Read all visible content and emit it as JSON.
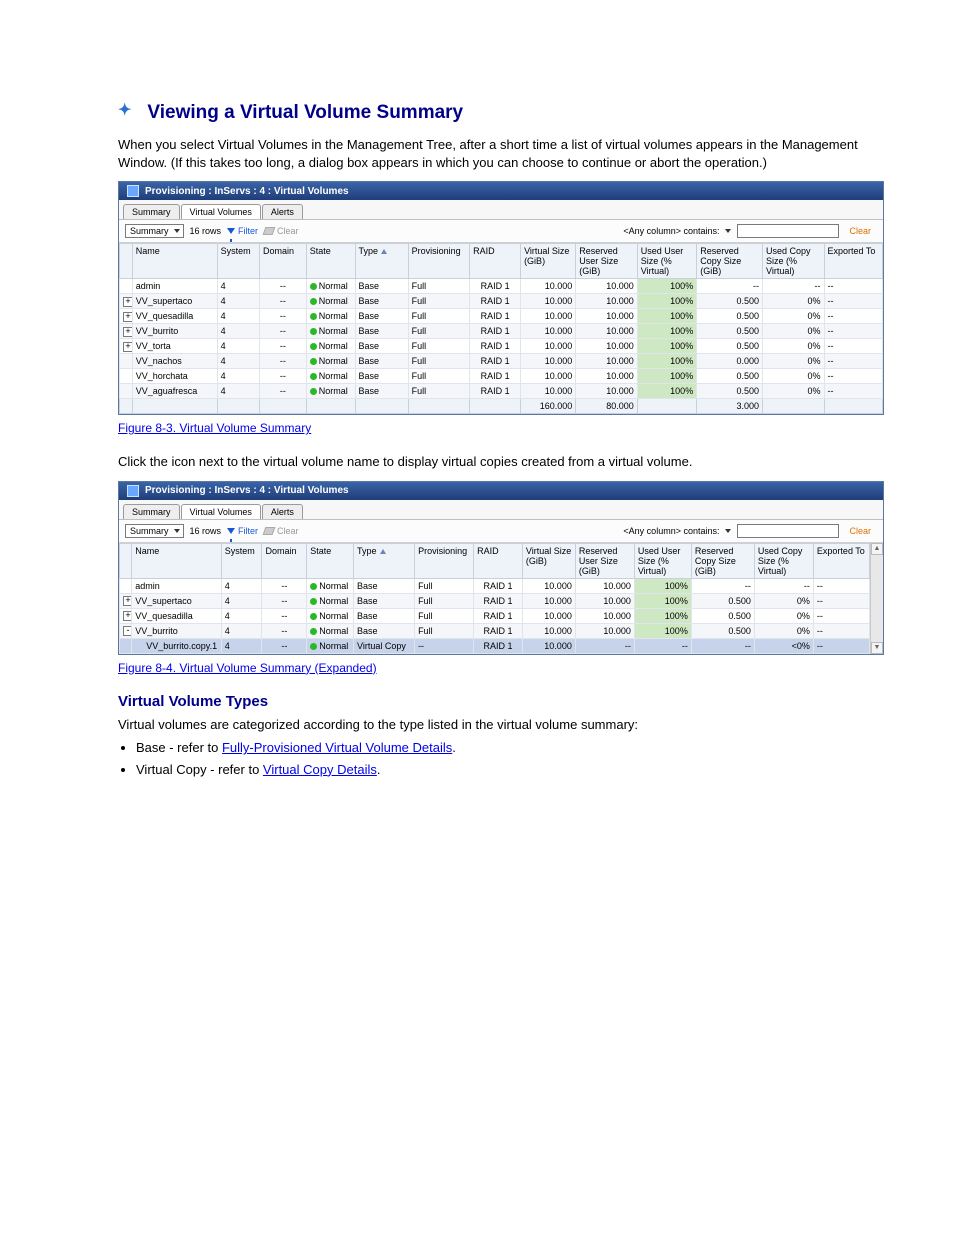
{
  "heading_top": "Viewing a Virtual Volume Summary",
  "intro": "When you select Virtual Volumes in the Management Tree, after a short time a list of virtual volumes appears in the Management Window. (If this takes too long, a dialog box appears in which you can choose to continue or abort the operation.)",
  "fig1": {
    "title": "Provisioning : InServs : 4 : Virtual Volumes",
    "tabs": [
      "Summary",
      "Virtual Volumes",
      "Alerts"
    ],
    "tabs_active": 1,
    "dropdown": "Summary",
    "rowcount": "16 rows",
    "filter_label": "Filter",
    "clear_label": "Clear",
    "anycol": "<Any column> contains:",
    "clear_link": "Clear",
    "columns": [
      "Name",
      "System",
      "Domain",
      "State",
      "Type",
      "Provisioning",
      "RAID",
      "Virtual Size (GiB)",
      "Reserved User Size (GiB)",
      "Used User Size (% Virtual)",
      "Reserved Copy Size (GiB)",
      "Used Copy Size (% Virtual)",
      "Exported To"
    ],
    "sort_col": 4,
    "rows": [
      {
        "tree": "",
        "name": "admin",
        "sys": "4",
        "dom": "--",
        "state": "Normal",
        "type": "Base",
        "prov": "Full",
        "raid": "RAID 1",
        "vs": "10.000",
        "rus": "10.000",
        "uus": "100%",
        "rcs": "--",
        "ucs": "--",
        "exp": "--"
      },
      {
        "tree": "+",
        "name": "VV_supertaco",
        "sys": "4",
        "dom": "--",
        "state": "Normal",
        "type": "Base",
        "prov": "Full",
        "raid": "RAID 1",
        "vs": "10.000",
        "rus": "10.000",
        "uus": "100%",
        "rcs": "0.500",
        "ucs": "0%",
        "exp": "--"
      },
      {
        "tree": "+",
        "name": "VV_quesadilla",
        "sys": "4",
        "dom": "--",
        "state": "Normal",
        "type": "Base",
        "prov": "Full",
        "raid": "RAID 1",
        "vs": "10.000",
        "rus": "10.000",
        "uus": "100%",
        "rcs": "0.500",
        "ucs": "0%",
        "exp": "--"
      },
      {
        "tree": "+",
        "name": "VV_burrito",
        "sys": "4",
        "dom": "--",
        "state": "Normal",
        "type": "Base",
        "prov": "Full",
        "raid": "RAID 1",
        "vs": "10.000",
        "rus": "10.000",
        "uus": "100%",
        "rcs": "0.500",
        "ucs": "0%",
        "exp": "--"
      },
      {
        "tree": "+",
        "name": "VV_torta",
        "sys": "4",
        "dom": "--",
        "state": "Normal",
        "type": "Base",
        "prov": "Full",
        "raid": "RAID 1",
        "vs": "10.000",
        "rus": "10.000",
        "uus": "100%",
        "rcs": "0.500",
        "ucs": "0%",
        "exp": "--"
      },
      {
        "tree": "",
        "name": "VV_nachos",
        "sys": "4",
        "dom": "--",
        "state": "Normal",
        "type": "Base",
        "prov": "Full",
        "raid": "RAID 1",
        "vs": "10.000",
        "rus": "10.000",
        "uus": "100%",
        "rcs": "0.000",
        "ucs": "0%",
        "exp": "--"
      },
      {
        "tree": "",
        "name": "VV_horchata",
        "sys": "4",
        "dom": "--",
        "state": "Normal",
        "type": "Base",
        "prov": "Full",
        "raid": "RAID 1",
        "vs": "10.000",
        "rus": "10.000",
        "uus": "100%",
        "rcs": "0.500",
        "ucs": "0%",
        "exp": "--"
      },
      {
        "tree": "",
        "name": "VV_aguafresca",
        "sys": "4",
        "dom": "--",
        "state": "Normal",
        "type": "Base",
        "prov": "Full",
        "raid": "RAID 1",
        "vs": "10.000",
        "rus": "10.000",
        "uus": "100%",
        "rcs": "0.500",
        "ucs": "0%",
        "exp": "--"
      }
    ],
    "footer": {
      "vs": "160.000",
      "rus": "80.000",
      "rcs": "3.000"
    }
  },
  "fig1_caption": "Figure 8-3.  Virtual Volume Summary",
  "tip": "Click the icon next to the virtual volume name to display virtual copies created from a virtual volume.",
  "fig2": {
    "title": "Provisioning : InServs : 4 : Virtual Volumes",
    "tabs": [
      "Summary",
      "Virtual Volumes",
      "Alerts"
    ],
    "tabs_active": 1,
    "dropdown": "Summary",
    "rowcount": "16 rows",
    "filter_label": "Filter",
    "clear_label": "Clear",
    "anycol": "<Any column> contains:",
    "clear_link": "Clear",
    "columns": [
      "Name",
      "System",
      "Domain",
      "State",
      "Type",
      "Provisioning",
      "RAID",
      "Virtual Size (GiB)",
      "Reserved User Size (GiB)",
      "Used User Size (% Virtual)",
      "Reserved Copy Size (GiB)",
      "Used Copy Size (% Virtual)",
      "Exported To"
    ],
    "sort_col": 4,
    "rows": [
      {
        "tree": "",
        "name": "admin",
        "sys": "4",
        "dom": "--",
        "state": "Normal",
        "type": "Base",
        "prov": "Full",
        "raid": "RAID 1",
        "vs": "10.000",
        "rus": "10.000",
        "uus": "100%",
        "rcs": "--",
        "ucs": "--",
        "exp": "--"
      },
      {
        "tree": "+",
        "name": "VV_supertaco",
        "sys": "4",
        "dom": "--",
        "state": "Normal",
        "type": "Base",
        "prov": "Full",
        "raid": "RAID 1",
        "vs": "10.000",
        "rus": "10.000",
        "uus": "100%",
        "rcs": "0.500",
        "ucs": "0%",
        "exp": "--"
      },
      {
        "tree": "+",
        "name": "VV_quesadilla",
        "sys": "4",
        "dom": "--",
        "state": "Normal",
        "type": "Base",
        "prov": "Full",
        "raid": "RAID 1",
        "vs": "10.000",
        "rus": "10.000",
        "uus": "100%",
        "rcs": "0.500",
        "ucs": "0%",
        "exp": "--"
      },
      {
        "tree": "-",
        "name": "VV_burrito",
        "sys": "4",
        "dom": "--",
        "state": "Normal",
        "type": "Base",
        "prov": "Full",
        "raid": "RAID 1",
        "vs": "10.000",
        "rus": "10.000",
        "uus": "100%",
        "rcs": "0.500",
        "ucs": "0%",
        "exp": "--"
      }
    ],
    "vcrow": {
      "name": "VV_burrito.copy.1",
      "sys": "4",
      "dom": "--",
      "state": "Normal",
      "type": "Virtual Copy",
      "prov": "--",
      "raid": "RAID 1",
      "vs": "10.000",
      "rus": "--",
      "uus": "--",
      "rcs": "--",
      "ucs": "<0%",
      "exp": "--"
    }
  },
  "fig2_caption": "Figure 8-4.  Virtual Volume Summary (Expanded)",
  "heading2": "Virtual Volume Types",
  "body2": "Virtual volumes are categorized according to the type listed in the virtual volume summary:",
  "bullets": [
    {
      "pre": "Base - refer to ",
      "link": "Fully-Provisioned Virtual Volume Details",
      "post": "."
    },
    {
      "pre": "Virtual Copy - refer to ",
      "link": "Virtual Copy Details",
      "post": "."
    }
  ]
}
